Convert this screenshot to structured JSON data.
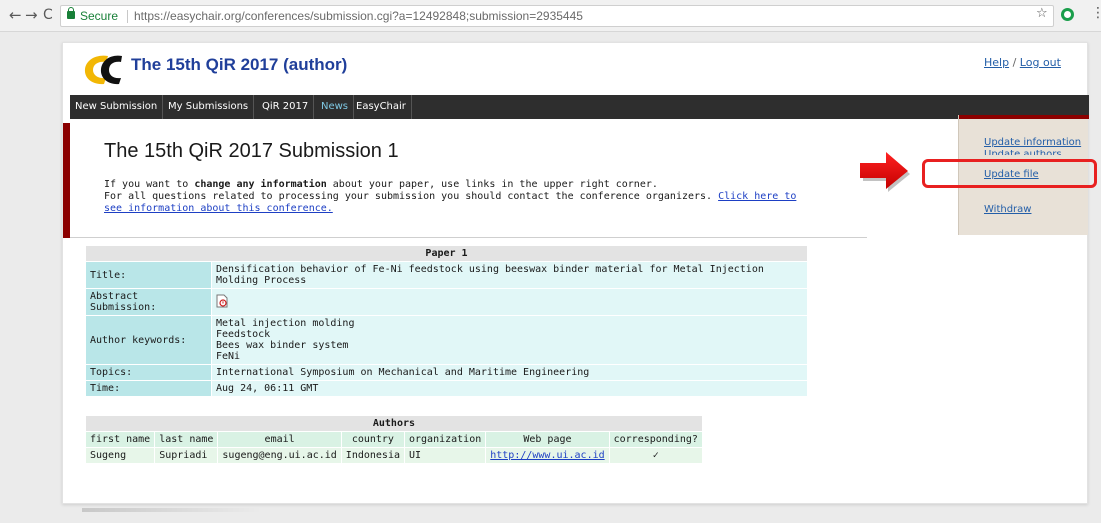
{
  "browser": {
    "back_icon": "arrow-left-icon",
    "forward_icon": "arrow-right-icon",
    "reload_icon": "reload-icon",
    "secure_label": "Secure",
    "url": "https://easychair.org/conferences/submission.cgi?a=12492848;submission=2935445",
    "star_icon": "star-icon",
    "menu_icon": "more-vert-icon"
  },
  "header": {
    "logo": "easychair-logo",
    "title": "The 15th QiR 2017 (author)",
    "help_label": "Help",
    "separator": "/",
    "logout_label": "Log out"
  },
  "menu": {
    "items": [
      {
        "label": "New Submission"
      },
      {
        "label": "My Submissions"
      },
      {
        "label": "QiR 2017"
      },
      {
        "label": "News"
      },
      {
        "label": "EasyChair"
      }
    ],
    "active": "News"
  },
  "main": {
    "title": "The 15th QiR 2017 Submission 1",
    "info_line1_pre": "If you want to ",
    "info_line1_bold": "change any information",
    "info_line1_post": " about your paper, use links in the upper right corner.",
    "info_line2_pre": "For all questions related to processing your submission you should contact the conference organizers. ",
    "info_link": "Click here to see information about this conference."
  },
  "side_panel": {
    "update_information": "Update information",
    "update_authors": "Update authors",
    "update_file": "Update file",
    "withdraw": "Withdraw"
  },
  "paper": {
    "caption": "Paper 1",
    "title_label": "Title:",
    "title_value": "Densification behavior of Fe-Ni feedstock using beeswax binder material for Metal Injection Molding Process",
    "abstract_label": "Abstract Submission:",
    "abstract_icon": "pdf-file-icon",
    "keywords_label": "Author keywords:",
    "keywords": [
      "Metal injection molding",
      "Feedstock",
      "Bees wax binder system",
      "FeNi"
    ],
    "topics_label": "Topics:",
    "topics_value": "International Symposium on Mechanical and Maritime Engineering",
    "time_label": "Time:",
    "time_value": "Aug 24, 06:11 GMT"
  },
  "authors": {
    "caption": "Authors",
    "columns": [
      "first name",
      "last name",
      "email",
      "country",
      "organization",
      "Web page",
      "corresponding?"
    ],
    "rows": [
      {
        "first_name": "Sugeng",
        "last_name": "Supriadi",
        "email": "sugeng@eng.ui.ac.id",
        "country": "Indonesia",
        "organization": "UI",
        "web_page": "http://www.ui.ac.id",
        "corresponding": "✓"
      }
    ]
  },
  "annotation": {
    "arrow_icon": "red-arrow-icon",
    "color": "#e82020"
  }
}
